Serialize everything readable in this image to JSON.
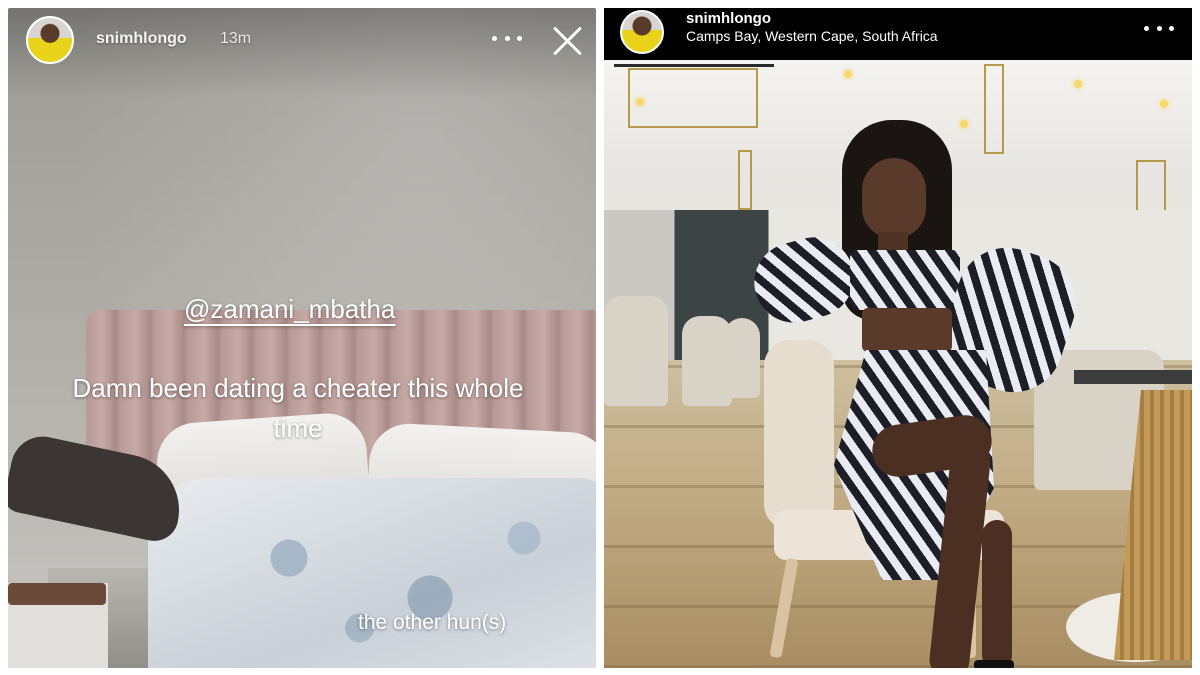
{
  "story": {
    "username": "snimhlongo",
    "timestamp": "13m",
    "mention": "@zamani_mbatha",
    "caption": "Damn been dating a cheater this whole time",
    "sticker_text": "the other hun(s)"
  },
  "post": {
    "username": "snimhlongo",
    "location": "Camps Bay, Western Cape, South Africa"
  },
  "icons": {
    "more": "more-options-icon",
    "close": "close-icon"
  },
  "colors": {
    "header_bg": "#000000",
    "text_white": "#ffffff"
  }
}
